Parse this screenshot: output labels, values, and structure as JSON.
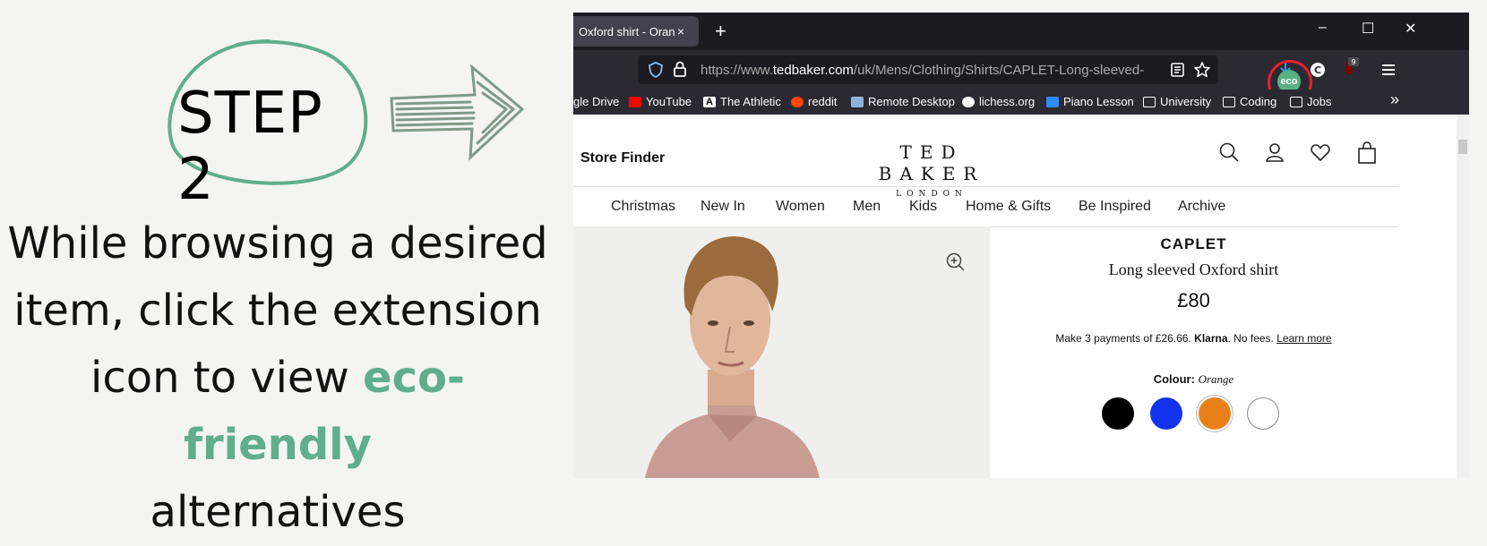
{
  "promo": {
    "step": "STEP 2",
    "desc_line1": "While browsing a desired",
    "desc_line2": "item, click the extension",
    "desc_line3_a": "icon to view ",
    "desc_line3_b": "eco-friendly",
    "desc_line4": "alternatives",
    "accent_color": "#5fae8d"
  },
  "browser": {
    "tab_title": "Oxford shirt - Orange",
    "tab_close": "×",
    "newtab": "+",
    "window_controls": [
      "–",
      "☐",
      "✕"
    ],
    "url_prefix": "https://www.",
    "url_domain": "tedbaker.com",
    "url_path": "/uk/Mens/Clothing/Shirts/CAPLET-Long-sleeved-",
    "extension_label": "eco",
    "badge_count": "9",
    "bookmarks": [
      {
        "label": "gle Drive",
        "icon": "drive-icon"
      },
      {
        "label": "YouTube",
        "icon": "youtube-icon"
      },
      {
        "label": "The Athletic",
        "icon": "athletic-icon"
      },
      {
        "label": "reddit",
        "icon": "reddit-icon"
      },
      {
        "label": "Remote Desktop",
        "icon": "remote-desktop-icon"
      },
      {
        "label": "lichess.org",
        "icon": "lichess-icon"
      },
      {
        "label": "Piano Lesson",
        "icon": "zoom-icon"
      },
      {
        "label": "University",
        "icon": "folder-icon"
      },
      {
        "label": "Coding",
        "icon": "folder-icon"
      },
      {
        "label": "Jobs",
        "icon": "folder-icon"
      }
    ],
    "overflow": "»"
  },
  "site": {
    "store_finder": "Store Finder",
    "logo_line1": "TED BAKER",
    "logo_line2": "LONDON",
    "nav": [
      "Christmas",
      "New In",
      "Women",
      "Men",
      "Kids",
      "Home & Gifts",
      "Be Inspired",
      "Archive"
    ],
    "product": {
      "name": "CAPLET",
      "description": "Long sleeved Oxford shirt",
      "price": "£80",
      "klarna_a": "Make 3 payments of £26.66. ",
      "klarna_b": "Klarna",
      "klarna_c": ". No fees. ",
      "klarna_link": "Learn more",
      "colour_label": "Colour:",
      "colour_value": "Orange",
      "swatches": [
        "#000000",
        "#1133ee",
        "#e8801a",
        "#ffffff"
      ]
    }
  }
}
